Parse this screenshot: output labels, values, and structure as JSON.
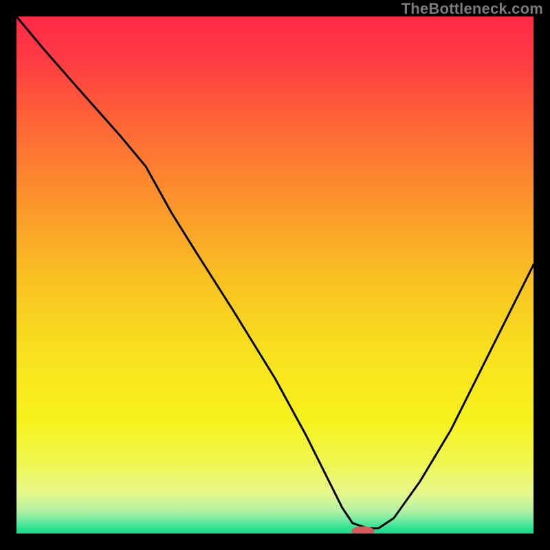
{
  "watermark": "TheBottleneck.com",
  "chart_data": {
    "type": "line",
    "title": "",
    "xlabel": "",
    "ylabel": "",
    "xlim": [
      0,
      100
    ],
    "ylim": [
      0,
      100
    ],
    "grid": false,
    "legend": false,
    "background_gradient": {
      "stops": [
        {
          "offset": 0.0,
          "color": "#ff2a46"
        },
        {
          "offset": 0.08,
          "color": "#ff3a44"
        },
        {
          "offset": 0.2,
          "color": "#fe6336"
        },
        {
          "offset": 0.35,
          "color": "#fb922c"
        },
        {
          "offset": 0.5,
          "color": "#f9bf22"
        },
        {
          "offset": 0.65,
          "color": "#f8e11e"
        },
        {
          "offset": 0.78,
          "color": "#f7f21c"
        },
        {
          "offset": 0.86,
          "color": "#f0f64e"
        },
        {
          "offset": 0.92,
          "color": "#e7f88a"
        },
        {
          "offset": 0.955,
          "color": "#b7f3a4"
        },
        {
          "offset": 0.975,
          "color": "#6de9a1"
        },
        {
          "offset": 0.99,
          "color": "#2be28f"
        },
        {
          "offset": 1.0,
          "color": "#16da86"
        }
      ]
    },
    "series": [
      {
        "name": "bottleneck-curve",
        "color": "#000000",
        "x": [
          0,
          5,
          12,
          20,
          25,
          30,
          35,
          42,
          50,
          56,
          60,
          63,
          65,
          68,
          70,
          73,
          78,
          84,
          90,
          96,
          100
        ],
        "y": [
          100,
          94,
          86,
          77,
          71,
          62,
          54,
          43,
          30,
          19,
          11,
          5,
          2,
          1,
          1,
          3,
          10,
          20,
          32,
          44,
          52
        ]
      }
    ],
    "marker": {
      "name": "optimal-point",
      "color": "#d85a5a",
      "x": 67,
      "y": 0.5,
      "rx": 2.2,
      "ry": 0.9
    }
  }
}
